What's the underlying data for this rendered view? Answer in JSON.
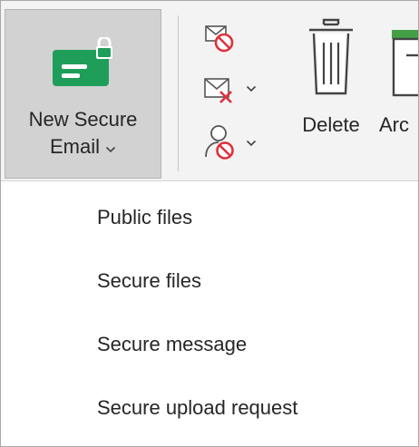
{
  "ribbon": {
    "new_secure_email": {
      "line1": "New Secure",
      "line2": "Email",
      "icon": "secure-email-lock-icon"
    },
    "block_sender_icon": "block-sender-icon",
    "ignore_icon": "ignore-conversation-icon",
    "report_icon": "report-user-icon",
    "delete_label": "Delete",
    "archive_label": "Arc",
    "colors": {
      "ribbon_bg": "#f3f3f3",
      "pressed_bg": "#d2d2d2",
      "secure_green": "#1f9e5a",
      "block_red": "#e0303a"
    }
  },
  "menu": {
    "items": [
      {
        "label": "Public files"
      },
      {
        "label": "Secure files"
      },
      {
        "label": "Secure message"
      },
      {
        "label": "Secure upload request"
      }
    ]
  }
}
